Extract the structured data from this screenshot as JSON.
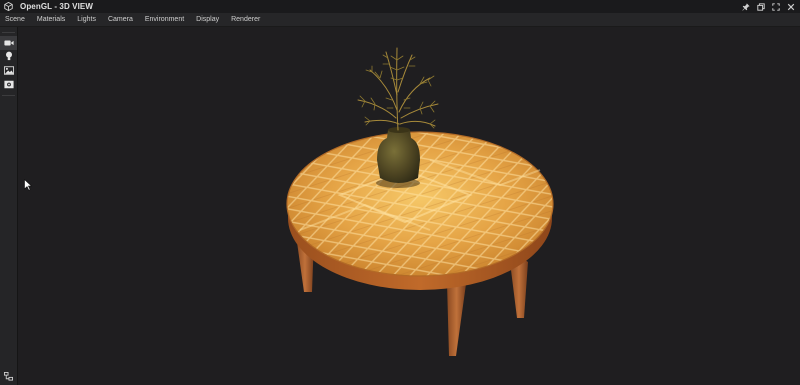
{
  "window": {
    "title": "OpenGL - 3D VIEW",
    "app_icon": "cube-icon",
    "controls": [
      "pin-icon",
      "restore-icon",
      "maximize-icon",
      "close-icon"
    ]
  },
  "menu": {
    "items": [
      "Scene",
      "Materials",
      "Lights",
      "Camera",
      "Environment",
      "Display",
      "Renderer"
    ]
  },
  "toolbar": {
    "tools": [
      "camera-icon",
      "light-bulb-icon",
      "environment-icon",
      "screenshot-icon"
    ],
    "bottom_tool": "hierarchy-icon"
  },
  "viewport": {
    "scene": "round wooden table with vase of dried plant",
    "background_color": "#1f1e20"
  },
  "colors": {
    "titlebar": "#1a1a1c",
    "menubar": "#262628",
    "toolbar_active": "#3a3a3d",
    "accent": "#ffffff"
  }
}
